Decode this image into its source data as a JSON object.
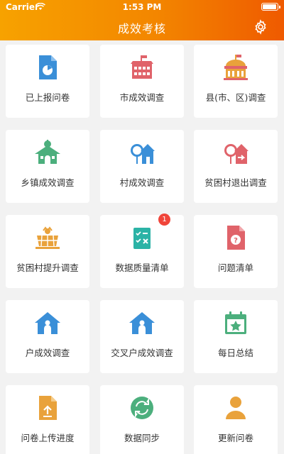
{
  "status_bar": {
    "carrier": "Carrier",
    "time": "1:53 PM"
  },
  "header": {
    "title": "成效考核"
  },
  "colors": {
    "header_start": "#f7a200",
    "header_end": "#ef5a00",
    "blue": "#3a8fd8",
    "red": "#e0636a",
    "orange": "#e9a23b",
    "green": "#4caf7d",
    "teal": "#2bb3a6"
  },
  "grid": {
    "items": [
      {
        "label": "已上报问卷",
        "icon": "report-pie-icon"
      },
      {
        "label": "市成效调查",
        "icon": "city-building-icon"
      },
      {
        "label": "县(市、区)调查",
        "icon": "county-hall-icon"
      },
      {
        "label": "乡镇成效调查",
        "icon": "township-house-icon"
      },
      {
        "label": "村成效调查",
        "icon": "village-tree-house-icon"
      },
      {
        "label": "贫困村退出调查",
        "icon": "village-exit-icon"
      },
      {
        "label": "贫困村提升调查",
        "icon": "solar-panel-icon"
      },
      {
        "label": "数据质量清单",
        "icon": "data-checklist-icon",
        "badge": "1"
      },
      {
        "label": "问题清单",
        "icon": "question-doc-icon"
      },
      {
        "label": "户成效调查",
        "icon": "household-person-icon"
      },
      {
        "label": "交叉户成效调查",
        "icon": "cross-household-icon"
      },
      {
        "label": "每日总结",
        "icon": "calendar-star-icon"
      },
      {
        "label": "问卷上传进度",
        "icon": "upload-doc-icon"
      },
      {
        "label": "数据同步",
        "icon": "sync-icon"
      },
      {
        "label": "更新问卷",
        "icon": "update-person-icon"
      }
    ]
  }
}
